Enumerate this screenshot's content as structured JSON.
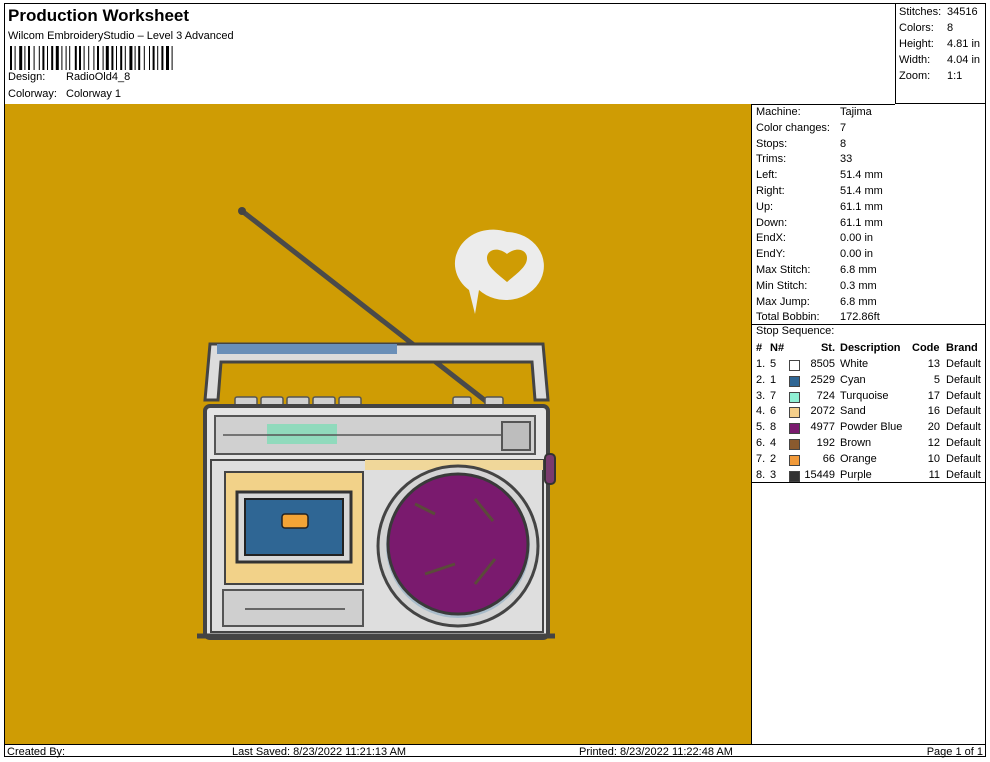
{
  "header": {
    "title": "Production Worksheet",
    "software": "Wilcom EmbroideryStudio – Level 3 Advanced",
    "design_label": "Design:",
    "design_value": "RadioOld4_8",
    "colorway_label": "Colorway:",
    "colorway_value": "Colorway 1"
  },
  "summary": {
    "stitches_label": "Stitches:",
    "stitches": "34516",
    "colors_label": "Colors:",
    "colors": "8",
    "height_label": "Height:",
    "height": "4.81 in",
    "width_label": "Width:",
    "width": "4.04 in",
    "zoom_label": "Zoom:",
    "zoom": "1:1"
  },
  "machine": [
    {
      "label": "Machine:",
      "value": "Tajima"
    },
    {
      "label": "Color changes:",
      "value": "7"
    },
    {
      "label": "Stops:",
      "value": "8"
    },
    {
      "label": "Trims:",
      "value": "33"
    },
    {
      "label": "Left:",
      "value": "51.4 mm"
    },
    {
      "label": "Right:",
      "value": "51.4 mm"
    },
    {
      "label": "Up:",
      "value": "61.1 mm"
    },
    {
      "label": "Down:",
      "value": "61.1 mm"
    },
    {
      "label": "EndX:",
      "value": "0.00 in"
    },
    {
      "label": "EndY:",
      "value": "0.00 in"
    },
    {
      "label": "Max Stitch:",
      "value": "6.8 mm"
    },
    {
      "label": "Min Stitch:",
      "value": "0.3 mm"
    },
    {
      "label": "Max Jump:",
      "value": "6.8 mm"
    },
    {
      "label": "Total Bobbin:",
      "value": "172.86ft"
    }
  ],
  "stop_sequence": {
    "title": "Stop Sequence:",
    "headers": {
      "num": "#",
      "n": "N#",
      "st": "St.",
      "desc": "Description",
      "code": "Code",
      "brand": "Brand"
    },
    "rows": [
      {
        "num": "1.",
        "n": "5",
        "color": "#ffffff",
        "st": "8505",
        "desc": "White",
        "code": "13",
        "brand": "Default"
      },
      {
        "num": "2.",
        "n": "1",
        "color": "#2f6694",
        "st": "2529",
        "desc": "Cyan",
        "code": "5",
        "brand": "Default"
      },
      {
        "num": "3.",
        "n": "7",
        "color": "#8ff0d4",
        "st": "724",
        "desc": "Turquoise",
        "code": "17",
        "brand": "Default"
      },
      {
        "num": "4.",
        "n": "6",
        "color": "#f4cf8a",
        "st": "2072",
        "desc": "Sand",
        "code": "16",
        "brand": "Default"
      },
      {
        "num": "5.",
        "n": "8",
        "color": "#7a1a6e",
        "st": "4977",
        "desc": "Powder Blue",
        "code": "20",
        "brand": "Default"
      },
      {
        "num": "6.",
        "n": "4",
        "color": "#8a5a2e",
        "st": "192",
        "desc": "Brown",
        "code": "12",
        "brand": "Default"
      },
      {
        "num": "7.",
        "n": "2",
        "color": "#f19a3a",
        "st": "66",
        "desc": "Orange",
        "code": "10",
        "brand": "Default"
      },
      {
        "num": "8.",
        "n": "3",
        "color": "#333333",
        "st": "15449",
        "desc": "Purple",
        "code": "11",
        "brand": "Default"
      }
    ]
  },
  "footer": {
    "created_by": "Created By:",
    "last_saved": "Last Saved: 8/23/2022 11:21:13 AM",
    "printed": "Printed: 8/23/2022 11:22:48 AM",
    "page": "Page 1 of 1"
  },
  "colors": {
    "canvas_bg": "#cf9c04"
  }
}
